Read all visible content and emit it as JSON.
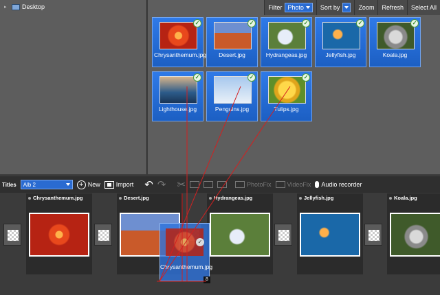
{
  "tree": {
    "root_label": "Desktop"
  },
  "toolbar": {
    "filter_label": "Filter",
    "filter_value": "Photo",
    "sort_label": "Sort by",
    "zoom_label": "Zoom",
    "refresh_label": "Refresh",
    "select_all_label": "Select All"
  },
  "photos": [
    {
      "caption": "Chrysanthemum.jpg",
      "icon": "check-icon"
    },
    {
      "caption": "Desert.jpg",
      "icon": "check-icon"
    },
    {
      "caption": "Hydrangeas.jpg",
      "icon": "check-icon"
    },
    {
      "caption": "Jellyfish.jpg",
      "icon": "check-icon"
    },
    {
      "caption": "Koala.jpg",
      "icon": "check-icon"
    },
    {
      "caption": "Lighthouse.jpg",
      "icon": "check-icon"
    },
    {
      "caption": "Penguins.jpg",
      "icon": "check-icon"
    },
    {
      "caption": "Tulips.jpg",
      "icon": "check-icon"
    }
  ],
  "midbar": {
    "titles_label": "Titles",
    "album_value": "Alb 2",
    "new_label": "New",
    "import_label": "Import",
    "photofix_label": "PhotoFix",
    "videofix_label": "VideoFix",
    "audio_label": "Audio recorder"
  },
  "timeline": {
    "clips": [
      {
        "title": "Chrysanthemum.jpg"
      },
      {
        "title": "Desert.jpg"
      },
      {
        "title": "Hydrangeas.jpg"
      },
      {
        "title": "Jellyfish.jpg"
      },
      {
        "title": "Koala.jpg"
      }
    ]
  },
  "drag": {
    "caption": "Chrysanthemum.jpg",
    "count": "8"
  },
  "colors": {
    "accent": "#2a6bd1",
    "tile": "#1c5fc3",
    "guide_line": "#d32020"
  }
}
